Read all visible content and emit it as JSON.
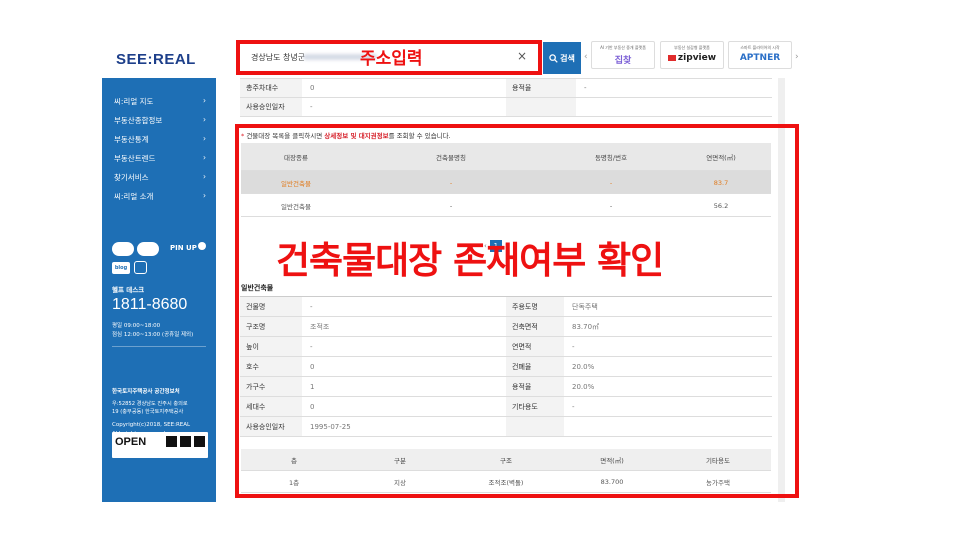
{
  "header": {
    "logo": "SEE:REAL",
    "search": {
      "value": "경상남도 창녕군",
      "clear": "×"
    },
    "search_button": "검색",
    "arrow_left": "‹",
    "arrow_right": "›",
    "banners": [
      {
        "caption": "AI 기반 부동산 중개 플랫폼",
        "brand": "집찾",
        "color": "#7b5fd6"
      },
      {
        "caption": "부동산 실감형 플랫폼",
        "brand": "zipview",
        "color": "#222222"
      },
      {
        "caption": "스마트 플라이어의 시작",
        "brand": "APTNER",
        "color": "#2a6fc7"
      }
    ]
  },
  "sidebar": {
    "nav": [
      {
        "label": "씨:리얼 지도",
        "arrow": "›"
      },
      {
        "label": "부동산종합정보",
        "arrow": "›"
      },
      {
        "label": "부동산통계",
        "arrow": "›"
      },
      {
        "label": "부동산트렌드",
        "arrow": "›"
      },
      {
        "label": "찾기서비스",
        "arrow": "›"
      },
      {
        "label": "씨:리얼 소개",
        "arrow": "›"
      }
    ],
    "pinup": "PIN UP",
    "blog": "blog",
    "helpdesk_title": "헬프 데스크",
    "phone": "1811-8680",
    "hours1": "평일 09:00~18:00",
    "hours2": "점심 12:00~13:00 (공휴일 제외)",
    "open_label": "OPEN",
    "org": "한국토지주택공사 공간정보처",
    "address1": "우:52852 경상남도 진주시 충의로",
    "address2": "19 (충무공동) 한국토지주택공사",
    "copyright1": "Copyright(c)2018, SEE:REAL",
    "copyright2": "ALL rights reserved."
  },
  "top_table": [
    {
      "label": "총주차대수",
      "value": "0",
      "label2": "용적율",
      "value2": "-"
    },
    {
      "label": "사용승인일자",
      "value": "-",
      "label2": "",
      "value2": ""
    }
  ],
  "notice": {
    "star": "*",
    "pre": " 건물대장 목록을 클릭하시면 ",
    "bold": "상세정보 및 대지권정보",
    "post": "를 조회할 수 있습니다."
  },
  "list_table": {
    "headers": [
      "대장종류",
      "건축물명칭",
      "동명칭/번호",
      "연면적(㎡)"
    ],
    "rows": [
      [
        "일반건축물",
        "-",
        "-",
        "83.7"
      ],
      [
        "일반건축물",
        "-",
        "-",
        "56.2"
      ]
    ]
  },
  "pager": {
    "prev": "‹",
    "current": "1",
    "next": "›"
  },
  "section_title": "일반건축물",
  "detail_table": [
    {
      "l1": "건물명",
      "v1": "-",
      "l2": "주용도명",
      "v2": "단독주택"
    },
    {
      "l1": "구조명",
      "v1": "조적조",
      "l2": "건축면적",
      "v2": "83.70㎡"
    },
    {
      "l1": "높이",
      "v1": "-",
      "l2": "연면적",
      "v2": "-"
    },
    {
      "l1": "호수",
      "v1": "0",
      "l2": "건폐율",
      "v2": "20.0%"
    },
    {
      "l1": "가구수",
      "v1": "1",
      "l2": "용적율",
      "v2": "20.0%"
    },
    {
      "l1": "세대수",
      "v1": "0",
      "l2": "기타용도",
      "v2": "-"
    },
    {
      "l1": "사용승인일자",
      "v1": "1995-07-25",
      "l2": "",
      "v2": ""
    }
  ],
  "floor_table": {
    "headers": [
      "층",
      "구분",
      "구조",
      "면적(㎡)",
      "기타용도"
    ],
    "rows": [
      [
        "1층",
        "지상",
        "조적조(벽돌)",
        "83.700",
        "농가주택"
      ]
    ]
  },
  "annotations": {
    "label1": "주소입력",
    "label2": "건축물대장 존재여부 확인",
    "color": "#ee1111"
  }
}
